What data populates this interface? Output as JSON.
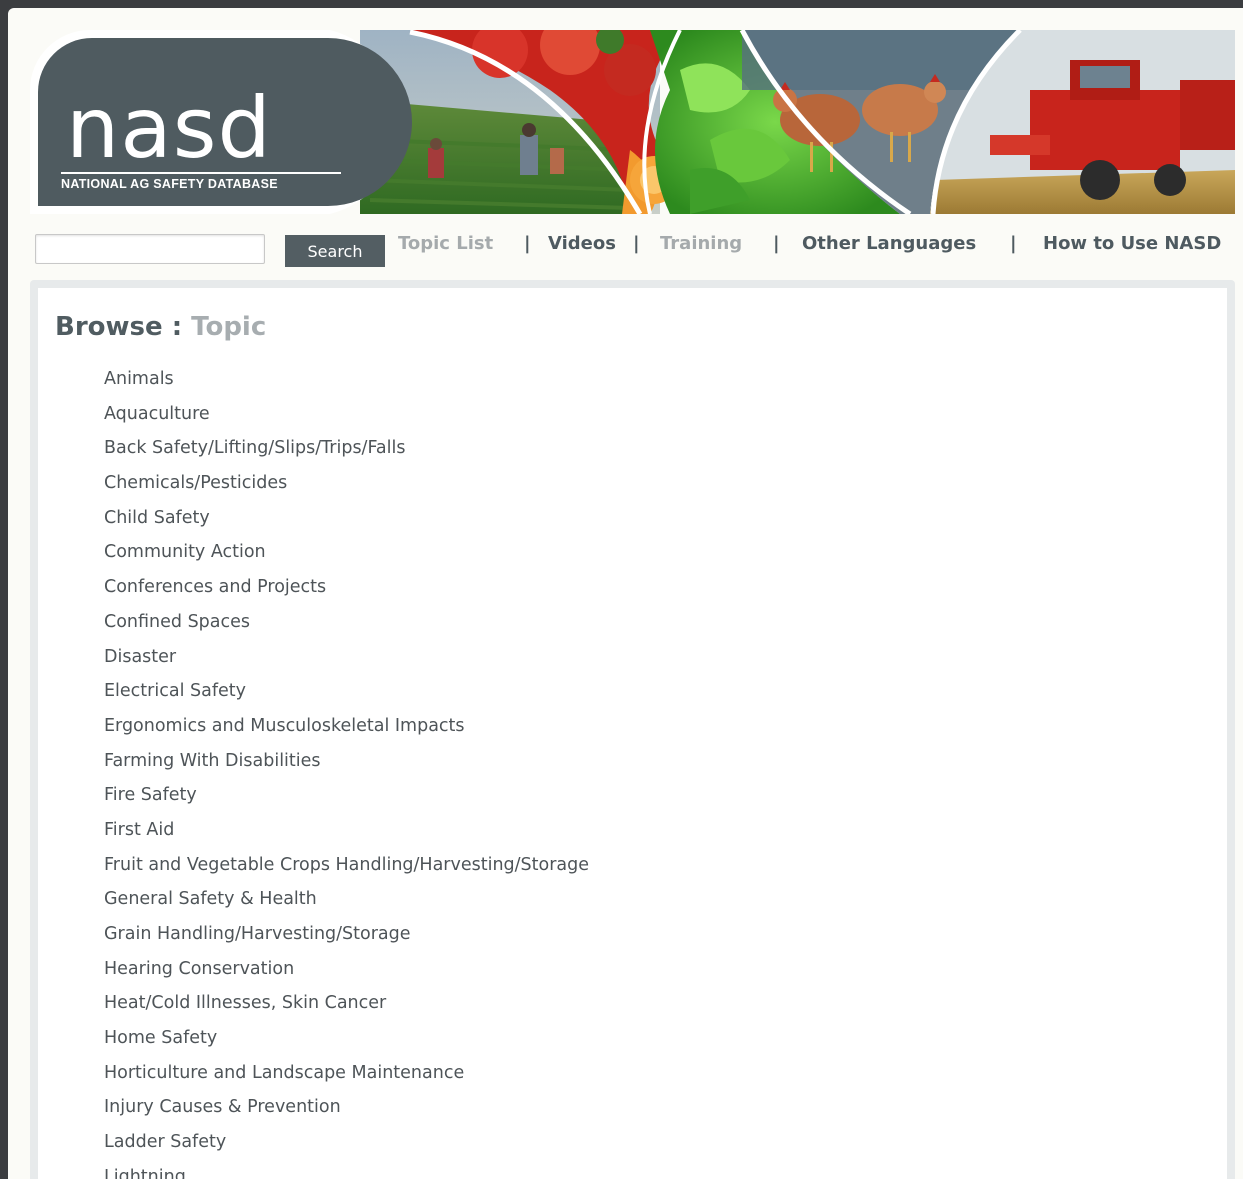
{
  "logo": {
    "wordmark": "nasd",
    "tagline": "NATIONAL AG SAFETY DATABASE"
  },
  "search": {
    "value": "",
    "placeholder": "",
    "button_label": "Search"
  },
  "nav": {
    "items": [
      {
        "label": "Topic List",
        "state": "active-muted"
      },
      {
        "label": "Videos",
        "state": "link"
      },
      {
        "label": "Training",
        "state": "muted"
      },
      {
        "label": "Other Languages",
        "state": "link"
      },
      {
        "label": "How to Use NASD",
        "state": "link"
      }
    ],
    "separator": "|"
  },
  "browse": {
    "label": "Browse",
    "colon": ":",
    "current": "Topic"
  },
  "topics": [
    "Animals",
    "Aquaculture",
    "Back Safety/Lifting/Slips/Trips/Falls",
    "Chemicals/Pesticides",
    "Child Safety",
    "Community Action",
    "Conferences and Projects",
    "Confined Spaces",
    "Disaster",
    "Electrical Safety",
    "Ergonomics and Musculoskeletal Impacts",
    "Farming With Disabilities",
    "Fire Safety",
    "First Aid",
    "Fruit and Vegetable Crops Handling/Harvesting/Storage",
    "General Safety & Health",
    "Grain Handling/Harvesting/Storage",
    "Hearing Conservation",
    "Heat/Cold Illnesses, Skin Cancer",
    "Home Safety",
    "Horticulture and Landscape Maintenance",
    "Injury Causes & Prevention",
    "Ladder Safety",
    "Lightning"
  ],
  "colors": {
    "page_background": "#3b3d40",
    "frame_background": "#fbfbf7",
    "logo_badge": "#4f5b60",
    "nav_link": "#4e5a60",
    "nav_muted": "#a5aaac",
    "button": "#535e63",
    "panel_border": "#e7eaeb",
    "heading_dark": "#505c61",
    "heading_light": "#a7adb0",
    "topic_text": "#4e5458"
  },
  "banner_images": [
    "field-workers",
    "tomatoes-oranges",
    "lettuce",
    "chickens",
    "combine-harvester"
  ]
}
